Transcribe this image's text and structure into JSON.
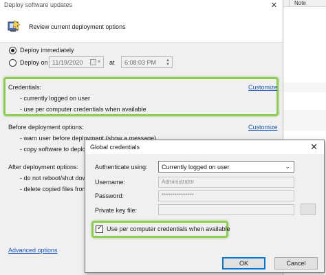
{
  "background_app": {
    "columns": [
      "Note"
    ]
  },
  "main_dialog": {
    "title": "Deploy software updates",
    "close_glyph": "✕",
    "header_text": "Review current deployment options",
    "app_icon": "deploy-app-icon",
    "schedule": {
      "deploy_immediately_label": "Deploy immediately",
      "deploy_on_label": "Deploy on",
      "deploy_on_selected": false,
      "deploy_immediately_selected": true,
      "date_value": "11/19/2020",
      "at_label": "at",
      "time_value": "6:08:03 PM"
    },
    "credentials": {
      "label": "Credentials:",
      "customize_label": "Customize",
      "items": [
        "- currently logged on user",
        "- use per computer credentials when available"
      ]
    },
    "before_deployment": {
      "label": "Before deployment options:",
      "customize_label": "Customize",
      "items": [
        "- warn user before deployment (show a message)",
        "- copy software to deploy t"
      ]
    },
    "after_deployment": {
      "label": "After deployment options:",
      "items": [
        "- do not reboot/shut down",
        "- delete copied files from re"
      ]
    },
    "advanced_options_label": "Advanced options"
  },
  "global_credentials": {
    "title": "Global credentials",
    "close_glyph": "✕",
    "authenticate_label": "Authenticate using:",
    "authenticate_value": "Currently logged on user",
    "username_label": "Username:",
    "username_value": "Administrator",
    "password_label": "Password:",
    "password_value": "***************",
    "private_key_label": "Private key file:",
    "private_key_value": "",
    "per_computer_label": "Use per computer credentials when available",
    "per_computer_checked": true,
    "ok_label": "OK",
    "cancel_label": "Cancel"
  },
  "colors": {
    "highlight_green": "#8ccf4f",
    "link_blue": "#1a56b8",
    "dialog_bg": "#f0f0f0",
    "default_button_border": "#0078d7"
  }
}
